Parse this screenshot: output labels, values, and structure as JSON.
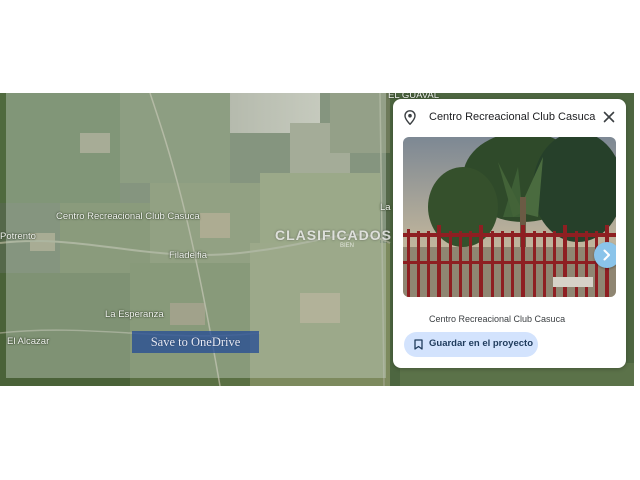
{
  "map": {
    "labels": {
      "el_guaval": "EL GUAVAL",
      "centro_recreacional": "Centro Recreacional Club Casuca",
      "potrento": "Potrento",
      "filadelfia": "Filadelfia",
      "la_esperanza": "La Esperanza",
      "el_alcazar": "El Alcazar",
      "la_partial": "La"
    },
    "watermark": "CLASIFICADOS",
    "watermark_sub": "BIEN",
    "onedrive_button": "Save to OneDrive"
  },
  "panel": {
    "title": "Centro Recreacional Club Casuca",
    "photo_caption": "Centro Recreacional Club Casuca",
    "save_button": "Guardar en el proyecto"
  },
  "colors": {
    "accent": "#d3e3fd",
    "carousel_button": "#8ac4ea",
    "fence": "#8e1f22"
  },
  "icons": [
    "location-pin-icon",
    "close-icon",
    "chevron-right-icon",
    "bookmark-icon"
  ]
}
